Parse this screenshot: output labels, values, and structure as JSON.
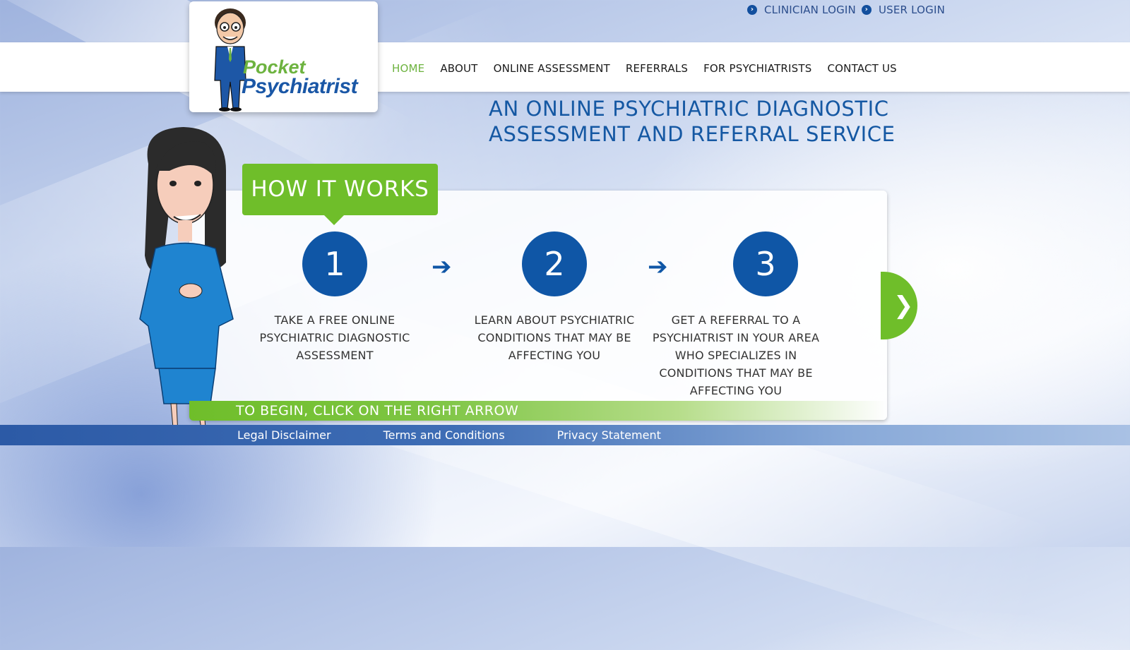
{
  "header": {
    "login_links": [
      {
        "label": "CLINICIAN LOGIN"
      },
      {
        "label": "USER LOGIN"
      }
    ]
  },
  "logo": {
    "line1": "Pocket",
    "line2": "Psychiatrist"
  },
  "nav": {
    "items": [
      {
        "label": "HOME",
        "active": true
      },
      {
        "label": "ABOUT"
      },
      {
        "label": "ONLINE ASSESSMENT"
      },
      {
        "label": "REFERRALS"
      },
      {
        "label": "FOR PSYCHIATRISTS"
      },
      {
        "label": "CONTACT US"
      }
    ]
  },
  "hero": {
    "headline_line1": "AN ONLINE PSYCHIATRIC DIAGNOSTIC",
    "headline_line2": "ASSESSMENT AND REFERRAL SERVICE"
  },
  "how_it_works": {
    "title": "HOW IT WORKS",
    "steps": [
      {
        "number": "1",
        "text": "TAKE A FREE ONLINE PSYCHIATRIC DIAGNOSTIC ASSESSMENT"
      },
      {
        "number": "2",
        "text": "LEARN ABOUT PSYCHIATRIC CONDITIONS THAT MAY BE AFFECTING YOU"
      },
      {
        "number": "3",
        "text": "GET A REFERRAL TO A PSYCHIATRIST IN YOUR AREA WHO SPECIALIZES IN CONDITIONS THAT MAY BE AFFECTING YOU"
      }
    ],
    "next_symbol": "❯",
    "begin_text": "TO BEGIN, CLICK ON THE RIGHT ARROW"
  },
  "footer": {
    "links": [
      {
        "label": "Legal Disclaimer"
      },
      {
        "label": "Terms and Conditions"
      },
      {
        "label": "Privacy Statement"
      }
    ]
  },
  "colors": {
    "brand_blue": "#0f56a6",
    "brand_green": "#6fbe2a"
  }
}
